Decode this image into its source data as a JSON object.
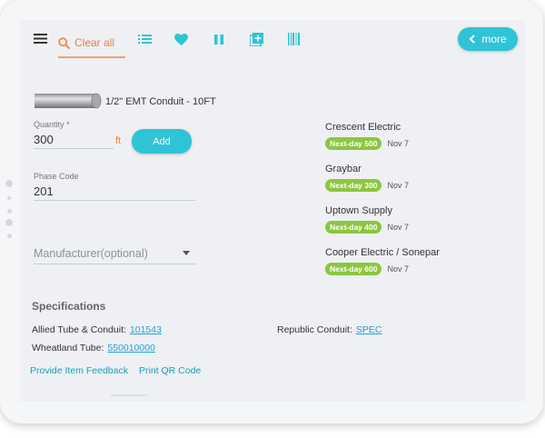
{
  "toolbar": {
    "menu_icon": "hamburger-icon",
    "clear_all_label": "Clear all",
    "list_icon": "list-icon",
    "favorite_icon": "heart-icon",
    "pause_icon": "pause-icon",
    "add_copy_icon": "add-to-list-icon",
    "barcode_icon": "barcode-icon",
    "more_label": "more",
    "accent_color": "#2ec4d6",
    "clear_color": "#ef7d45"
  },
  "product": {
    "name": "1/2\" EMT Conduit - 10FT"
  },
  "quantity": {
    "label": "Quantity *",
    "value": "300",
    "unit": "ft",
    "add_label": "Add"
  },
  "phase_code": {
    "label": "Phase Code",
    "value": "201"
  },
  "manufacturer": {
    "placeholder": "Manufacturer(optional)"
  },
  "suppliers": [
    {
      "name": "Crescent Electric",
      "badge": "Next-day 500",
      "date": "Nov 7"
    },
    {
      "name": "Graybar",
      "badge": "Next-day 300",
      "date": "Nov 7"
    },
    {
      "name": "Uptown Supply",
      "badge": "Next-day 400",
      "date": "Nov 7"
    },
    {
      "name": "Cooper Electric / Sonepar",
      "badge": "Next-day 600",
      "date": "Nov 7"
    }
  ],
  "specifications": {
    "title": "Specifications",
    "items": [
      {
        "label": "Allied Tube & Conduit:",
        "value": "101543"
      },
      {
        "label": "Republic Conduit:",
        "value": "SPEC"
      },
      {
        "label": "Wheatland Tube:",
        "value": "550010000"
      }
    ]
  },
  "actions": {
    "feedback": "Provide Item Feedback",
    "qr": "Print QR Code"
  }
}
